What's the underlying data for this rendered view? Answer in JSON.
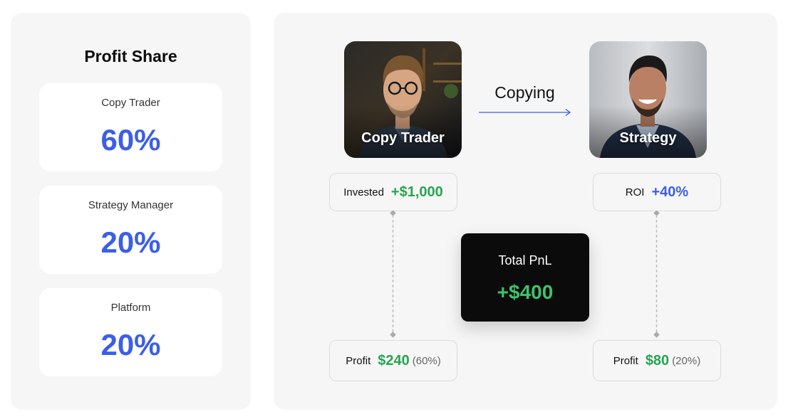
{
  "profit_share": {
    "title": "Profit Share",
    "cards": [
      {
        "label": "Copy Trader",
        "value": "60%"
      },
      {
        "label": "Strategy Manager",
        "value": "20%"
      },
      {
        "label": "Platform",
        "value": "20%"
      }
    ]
  },
  "flow": {
    "copy_trader_caption": "Copy Trader",
    "strategy_caption": "Strategy",
    "copying_label": "Copying",
    "invested": {
      "label": "Invested",
      "value": "+$1,000"
    },
    "roi": {
      "label": "ROI",
      "value": "+40%"
    },
    "total_pnl": {
      "label": "Total PnL",
      "value": "+$400"
    },
    "trader_profit": {
      "label": "Profit",
      "value": "$240",
      "share": "(60%)"
    },
    "strategy_profit": {
      "label": "Profit",
      "value": "$80",
      "share": "(20%)"
    }
  },
  "colors": {
    "accent_blue": "#3c5ee8",
    "profit_green": "#27a550",
    "pnl_green": "#3cc46a",
    "panel_bg": "#f6f6f6",
    "pnl_card_bg": "#0b0b0b"
  }
}
